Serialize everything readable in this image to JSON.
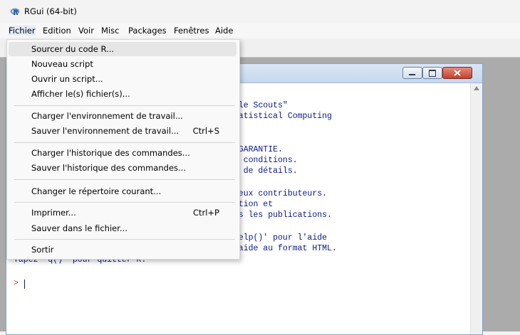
{
  "app": {
    "title": "RGui (64-bit)",
    "icon": "r-logo-icon"
  },
  "menubar": {
    "items": [
      "Fichier",
      "Edition",
      "Voir",
      "Misc",
      "Packages",
      "Fenêtres",
      "Aide"
    ]
  },
  "file_menu": {
    "items": [
      {
        "label": "Sourcer du code R...",
        "shortcut": ""
      },
      {
        "label": "Nouveau script",
        "shortcut": ""
      },
      {
        "label": "Ouvrir un script...",
        "shortcut": ""
      },
      {
        "label": "Afficher le(s) fichier(s)...",
        "shortcut": ""
      },
      {
        "label": "Charger l'environnement de travail...",
        "shortcut": ""
      },
      {
        "label": "Sauver l'environnement de travail...",
        "shortcut": "Ctrl+S"
      },
      {
        "label": "Charger l'historique des commandes...",
        "shortcut": ""
      },
      {
        "label": "Sauver l'historique des commandes...",
        "shortcut": ""
      },
      {
        "label": "Changer le répertoire courant...",
        "shortcut": ""
      },
      {
        "label": "Imprimer...",
        "shortcut": "Ctrl+P"
      },
      {
        "label": "Sauver dans le fichier...",
        "shortcut": ""
      },
      {
        "label": "Sortir",
        "shortcut": ""
      }
    ]
  },
  "console": {
    "visible_lines": [
      "agle Scouts\"",
      "Statistical Computing",
      ")",
      "E GARANTIE.",
      "es conditions.",
      "us de détails.",
      "breux contributeurs.",
      "mation et",
      "ans les publications.",
      "'help()' pour l'aide",
      "l'aide au format HTML.",
      "Tapez 'q()' pour quitter R."
    ],
    "prompt": ">"
  },
  "colors": {
    "console_text": "#0a1a8c",
    "prompt": "#e03030",
    "workspace_bg": "#ababab"
  }
}
